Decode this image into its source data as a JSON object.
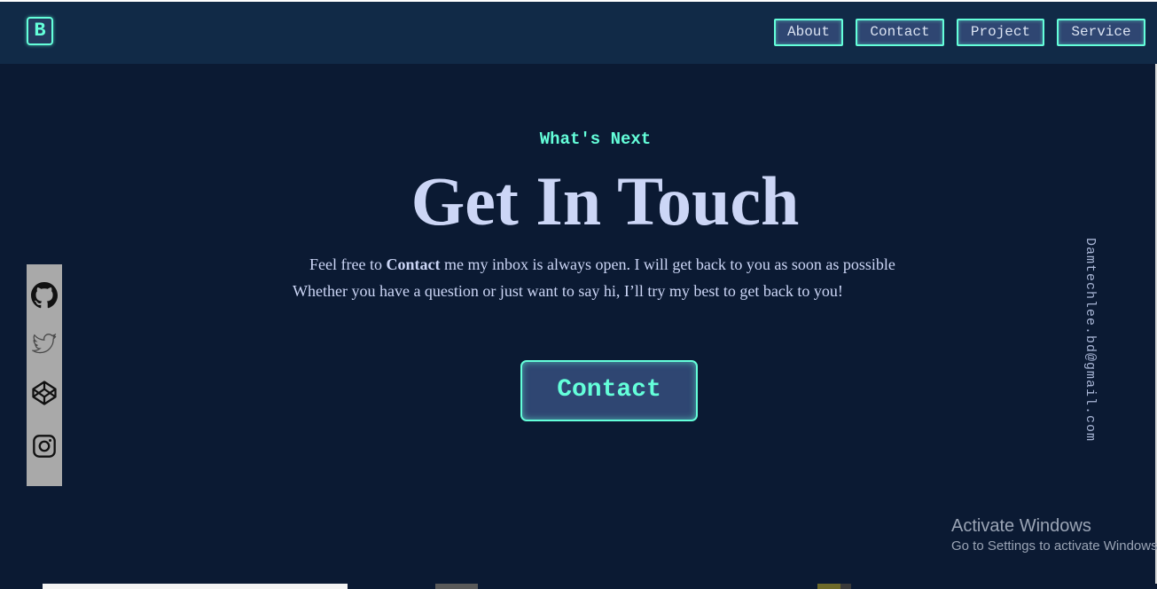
{
  "navbar": {
    "logo_letter": "B",
    "links": [
      "About",
      "Contact",
      "Project",
      "Service"
    ]
  },
  "hero": {
    "eyebrow": "What's Next",
    "title": "Get In Touch",
    "line1_prefix": "Feel free to ",
    "line1_bold": "Contact",
    "line1_suffix": " me my inbox is always open. I will get back to you as soon as possible",
    "line2": "Whether you have a question or just want to say hi, I’ll try my best to get back to you!",
    "cta_label": "Contact"
  },
  "social": {
    "icons": [
      "github-icon",
      "twitter-icon",
      "codepen-icon",
      "instagram-icon"
    ]
  },
  "email": "Damtechlee.bd@gmail.com",
  "watermark": {
    "title": "Activate Windows",
    "subtitle": "Go to Settings to activate Windows."
  },
  "colors": {
    "background": "#0b1a33",
    "navbar": "#112a47",
    "accent": "#64ffda",
    "text": "#ccd6f6",
    "button_fill": "#2f4672",
    "social_bar": "#a9a9a9"
  }
}
